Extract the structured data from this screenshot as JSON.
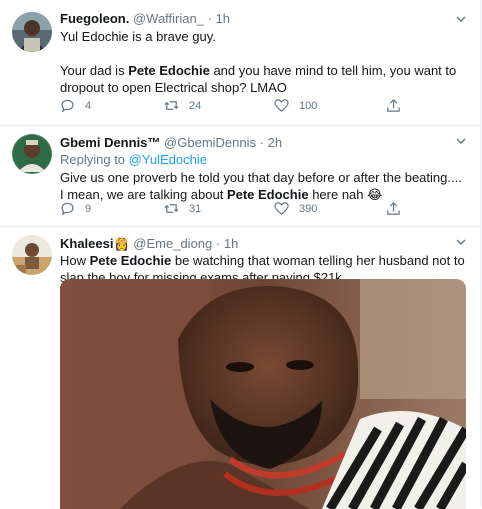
{
  "tweets": [
    {
      "name": "Fuegoleon.",
      "handle": "@Waffirian_",
      "dot": "·",
      "time": "1h",
      "body_line1": "Yul Edochie is a brave guy.",
      "body_pre": "Your dad is ",
      "body_bold": "Pete Edochie",
      "body_post": " and you have mind to tell him, you want to dropout to open Electrical shop? LMAO",
      "replies": "4",
      "retweets": "24",
      "likes": "100"
    },
    {
      "name": "Gbemi Dennis™",
      "handle": "@GbemiDennis",
      "dot": "·",
      "time": "2h",
      "replying_label": "Replying to",
      "replying_to": "@YulEdochie",
      "body_pre": "Give us one proverb he told you that day before or after the beating.... I mean, we are talking about ",
      "body_bold": "Pete Edochie",
      "body_post": " here nah 😂",
      "replies": "9",
      "retweets": "31",
      "likes": "390"
    },
    {
      "name": "Khaleesi",
      "name_emoji": "👸",
      "handle": "@Eme_diong",
      "dot": "·",
      "time": "1h",
      "body_pre": "How ",
      "body_bold": "Pete Edochie",
      "body_post": " be watching that woman telling her husband not to slap the boy for missing exams after paying $21k"
    }
  ],
  "icons": {
    "reply": "reply-icon",
    "retweet": "retweet-icon",
    "like": "heart-icon",
    "share": "share-icon",
    "more": "chevron-down-icon"
  },
  "colors": {
    "link": "#1da1f2",
    "muted": "#657786",
    "divider": "#e6ecf0"
  }
}
